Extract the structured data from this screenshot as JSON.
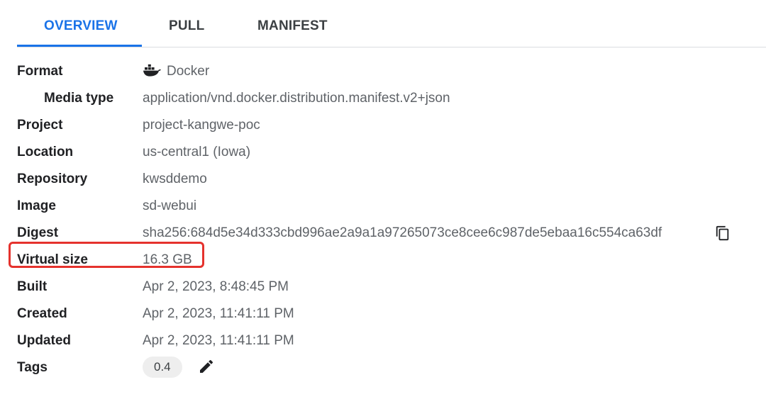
{
  "tabs": [
    {
      "label": "OVERVIEW",
      "active": true
    },
    {
      "label": "PULL",
      "active": false
    },
    {
      "label": "MANIFEST",
      "active": false
    }
  ],
  "details": {
    "format": {
      "label": "Format",
      "value": "Docker",
      "icon": "docker-icon"
    },
    "media_type": {
      "label": "Media type",
      "value": "application/vnd.docker.distribution.manifest.v2+json"
    },
    "project": {
      "label": "Project",
      "value": "project-kangwe-poc"
    },
    "location": {
      "label": "Location",
      "value": "us-central1 (Iowa)"
    },
    "repository": {
      "label": "Repository",
      "value": "kwsddemo"
    },
    "image": {
      "label": "Image",
      "value": "sd-webui"
    },
    "digest": {
      "label": "Digest",
      "value": "sha256:684d5e34d333cbd996ae2a9a1a97265073ce8cee6c987de5ebaa16c554ca63df",
      "icon": "copy-icon"
    },
    "virtual_size": {
      "label": "Virtual size",
      "value": "16.3 GB"
    },
    "built": {
      "label": "Built",
      "value": "Apr 2, 2023, 8:48:45 PM"
    },
    "created": {
      "label": "Created",
      "value": "Apr 2, 2023, 11:41:11 PM"
    },
    "updated": {
      "label": "Updated",
      "value": "Apr 2, 2023, 11:41:11 PM"
    },
    "tags": {
      "label": "Tags",
      "values": [
        "0.4"
      ],
      "icon": "edit-icon"
    }
  },
  "colors": {
    "accent": "#1a73e8",
    "highlight_box": "#e5322d",
    "label_text": "#202124",
    "value_text": "#5f6368"
  }
}
